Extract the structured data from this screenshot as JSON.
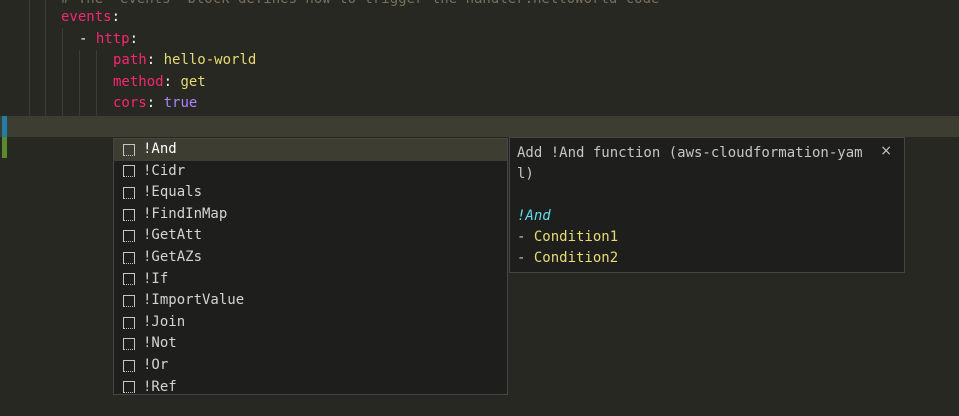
{
  "editor": {
    "comment_line": "# The `events` block defines how to trigger the handler.helloWorld code",
    "events_key": "events",
    "colon": ":",
    "dash": "- ",
    "http_key": "http",
    "path_key": "path",
    "path_value": "hello-world",
    "method_key": "method",
    "method_value": "get",
    "cors_key": "cors",
    "cors_value": "true"
  },
  "suggestions": {
    "items": [
      {
        "label": "!And"
      },
      {
        "label": "!Cidr"
      },
      {
        "label": "!Equals"
      },
      {
        "label": "!FindInMap"
      },
      {
        "label": "!GetAtt"
      },
      {
        "label": "!GetAZs"
      },
      {
        "label": "!If"
      },
      {
        "label": "!ImportValue"
      },
      {
        "label": "!Join"
      },
      {
        "label": "!Not"
      },
      {
        "label": "!Or"
      },
      {
        "label": "!Ref"
      }
    ],
    "selected_index": 0,
    "icon": "snippet-icon"
  },
  "details": {
    "title": "Add !And function (aws-cloudformation-yaml)",
    "close_glyph": "×",
    "doc_function": "!And",
    "doc_dash": "- ",
    "doc_args": [
      "Condition1",
      "Condition2"
    ]
  },
  "colors": {
    "background": "#272822",
    "keyword": "#f92672",
    "string": "#e6db74",
    "boolean": "#ae81ff",
    "widget_bg": "#1e1f1c"
  }
}
